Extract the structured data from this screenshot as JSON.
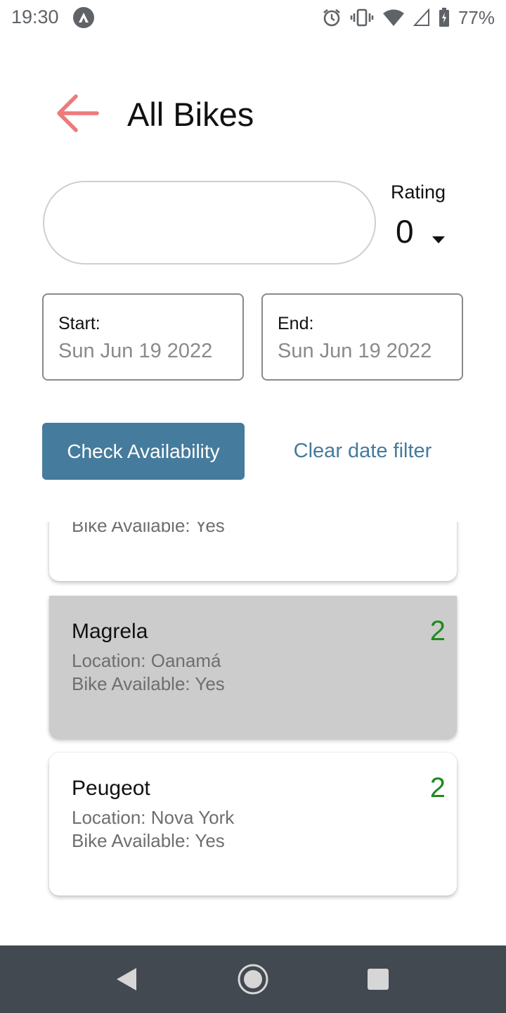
{
  "status_bar": {
    "time": "19:30",
    "battery_percent": "77%",
    "icons": [
      "app-notification-icon",
      "alarm-icon",
      "vibrate-icon",
      "wifi-icon",
      "cell-signal-icon",
      "battery-icon"
    ]
  },
  "header": {
    "title": "All Bikes",
    "back_icon": "arrow-left-icon"
  },
  "search": {
    "value": "",
    "placeholder": ""
  },
  "rating_filter": {
    "label": "Rating",
    "value": "0"
  },
  "dates": {
    "start": {
      "label": "Start:",
      "value": "Sun Jun 19 2022"
    },
    "end": {
      "label": "End:",
      "value": "Sun Jun 19 2022"
    }
  },
  "actions": {
    "check_label": "Check Availability",
    "clear_label": "Clear date filter"
  },
  "bikes": [
    {
      "name": "",
      "location": "",
      "available": "Bike Available: Yes",
      "rating": ""
    },
    {
      "name": "Magrela",
      "location": "Location: Oanamá",
      "available": "Bike Available: Yes",
      "rating": "2"
    },
    {
      "name": "Peugeot",
      "location": "Location: Nova York",
      "available": "Bike Available: Yes",
      "rating": "2"
    }
  ],
  "colors": {
    "accent": "#457b9d",
    "back_arrow": "#ec7b7b",
    "rating_text": "#1e8a1e",
    "selected_card": "#cccccc",
    "nav_bar": "#434950"
  },
  "nav_bar": {
    "icons": [
      "back-triangle-icon",
      "home-circle-icon",
      "recents-square-icon"
    ]
  }
}
